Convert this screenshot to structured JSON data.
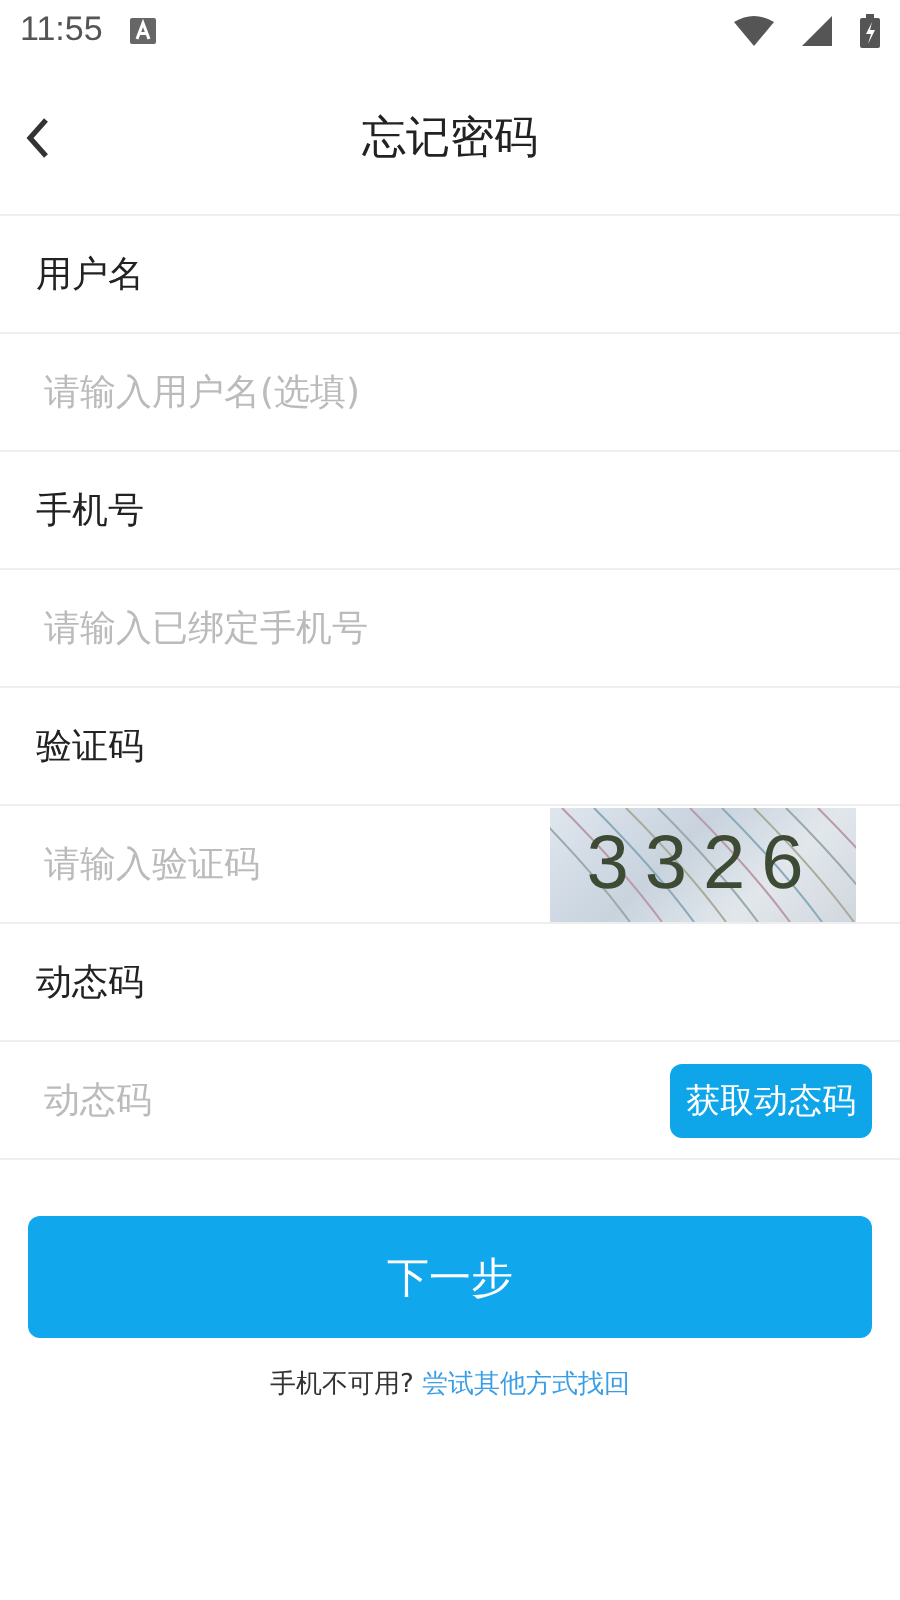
{
  "status_bar": {
    "time": "11:55"
  },
  "header": {
    "title": "忘记密码"
  },
  "sections": [
    {
      "kind": "plain",
      "label": "用户名",
      "placeholder": "请输入用户名(选填)"
    },
    {
      "kind": "plain",
      "label": "手机号",
      "placeholder": "请输入已绑定手机号"
    },
    {
      "kind": "captcha",
      "label": "验证码",
      "placeholder": "请输入验证码",
      "captcha": "3326"
    },
    {
      "kind": "sms",
      "label": "动态码",
      "placeholder": "动态码",
      "button": "获取动态码"
    }
  ],
  "next_button": "下一步",
  "footer": {
    "text": "手机不可用?",
    "link": "尝试其他方式找回"
  }
}
